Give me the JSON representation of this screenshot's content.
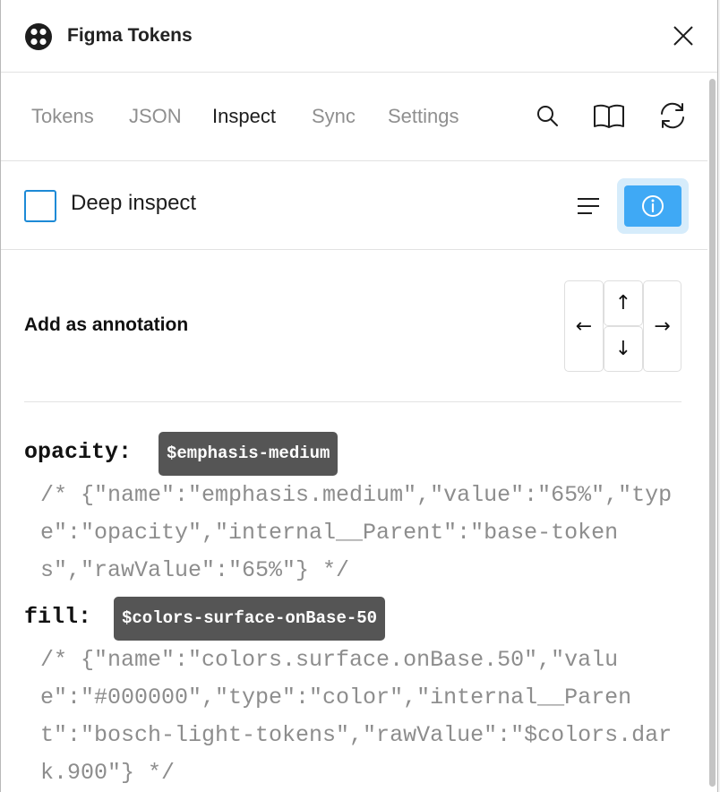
{
  "titlebar": {
    "title": "Figma Tokens"
  },
  "tabs": [
    {
      "label": "Tokens"
    },
    {
      "label": "JSON"
    },
    {
      "label": "Inspect"
    },
    {
      "label": "Sync"
    },
    {
      "label": "Settings"
    }
  ],
  "active_tab": "Inspect",
  "toolbar_icons": [
    "search-icon",
    "book-icon",
    "refresh-icon"
  ],
  "inspect": {
    "deep_inspect_label": "Deep inspect",
    "deep_inspect_checked": false
  },
  "annotation": {
    "label": "Add as annotation",
    "arrows": {
      "left": "←",
      "up": "↑",
      "down": "↓",
      "right": "→"
    }
  },
  "tokens": [
    {
      "property": "opacity:",
      "token": "$emphasis-medium",
      "comment": "/* {\"name\":\"emphasis.medium\",\"value\":\"65%\",\"type\":\"opacity\",\"internal__Parent\":\"base-tokens\",\"rawValue\":\"65%\"} */"
    },
    {
      "property": "fill:",
      "token": "$colors-surface-onBase-50",
      "comment": "/* {\"name\":\"colors.surface.onBase.50\",\"value\":\"#000000\",\"type\":\"color\",\"internal__Parent\":\"bosch-light-tokens\",\"rawValue\":\"$colors.dark.900\"} */"
    }
  ],
  "colors": {
    "accent": "#3fa9f5",
    "accent_light": "#d6ecfb",
    "checkbox_border": "#1d8ad6",
    "badge_bg": "#555555"
  }
}
